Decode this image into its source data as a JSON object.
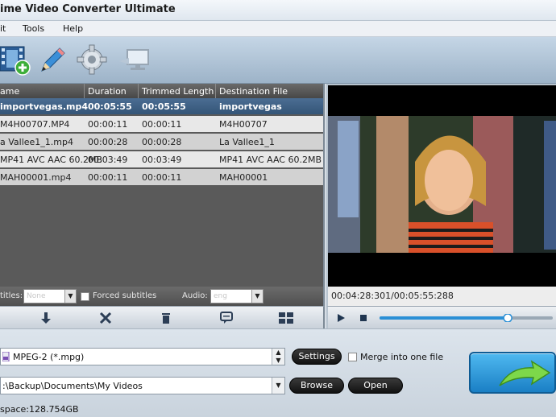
{
  "window": {
    "title": "ime Video Converter Ultimate"
  },
  "menu": {
    "items": [
      "it",
      "Tools",
      "Help"
    ]
  },
  "toolbar": {
    "icons": [
      "add-video-icon",
      "edit-pencil-icon",
      "settings-gear-icon",
      "monitor-icon"
    ]
  },
  "file_list": {
    "columns": [
      "ame",
      "Duration",
      "Trimmed Length",
      "Destination File"
    ],
    "rows": [
      {
        "name": "importvegas.mp4",
        "duration": "00:05:55",
        "trimmed": "00:05:55",
        "destination": "importvegas",
        "selected": true
      },
      {
        "name": "M4H00707.MP4",
        "duration": "00:00:11",
        "trimmed": "00:00:11",
        "destination": "M4H00707",
        "selected": false
      },
      {
        "name": "a Vallee1_1.mp4",
        "duration": "00:00:28",
        "trimmed": "00:00:28",
        "destination": "La Vallee1_1",
        "selected": false
      },
      {
        "name": "MP41 AVC AAC 60.2MB",
        "duration": "00:03:49",
        "trimmed": "00:03:49",
        "destination": "MP41 AVC AAC 60.2MB",
        "selected": false
      },
      {
        "name": "MAH00001.mp4",
        "duration": "00:00:11",
        "trimmed": "00:00:11",
        "destination": "MAH00001",
        "selected": false
      }
    ]
  },
  "subtitles": {
    "label": "titles:",
    "value": "None",
    "forced_label": "Forced subtitles",
    "audio_label": "Audio:",
    "audio_value": "eng"
  },
  "preview": {
    "timestamp": "00:04:28:301/00:05:55:288",
    "seek_fraction": 0.74
  },
  "output": {
    "format_value": "MPEG-2 (*.mpg)",
    "settings_label": "Settings",
    "merge_label": "Merge into one file",
    "path_value": ":\\Backup\\Documents\\My Videos",
    "browse_label": "Browse",
    "open_label": "Open",
    "free_space": "space:128.754GB"
  },
  "colors": {
    "selected_row": "#3d6189",
    "toolbar": "#a9bdd0",
    "convert_button": "#2a8fd6"
  }
}
